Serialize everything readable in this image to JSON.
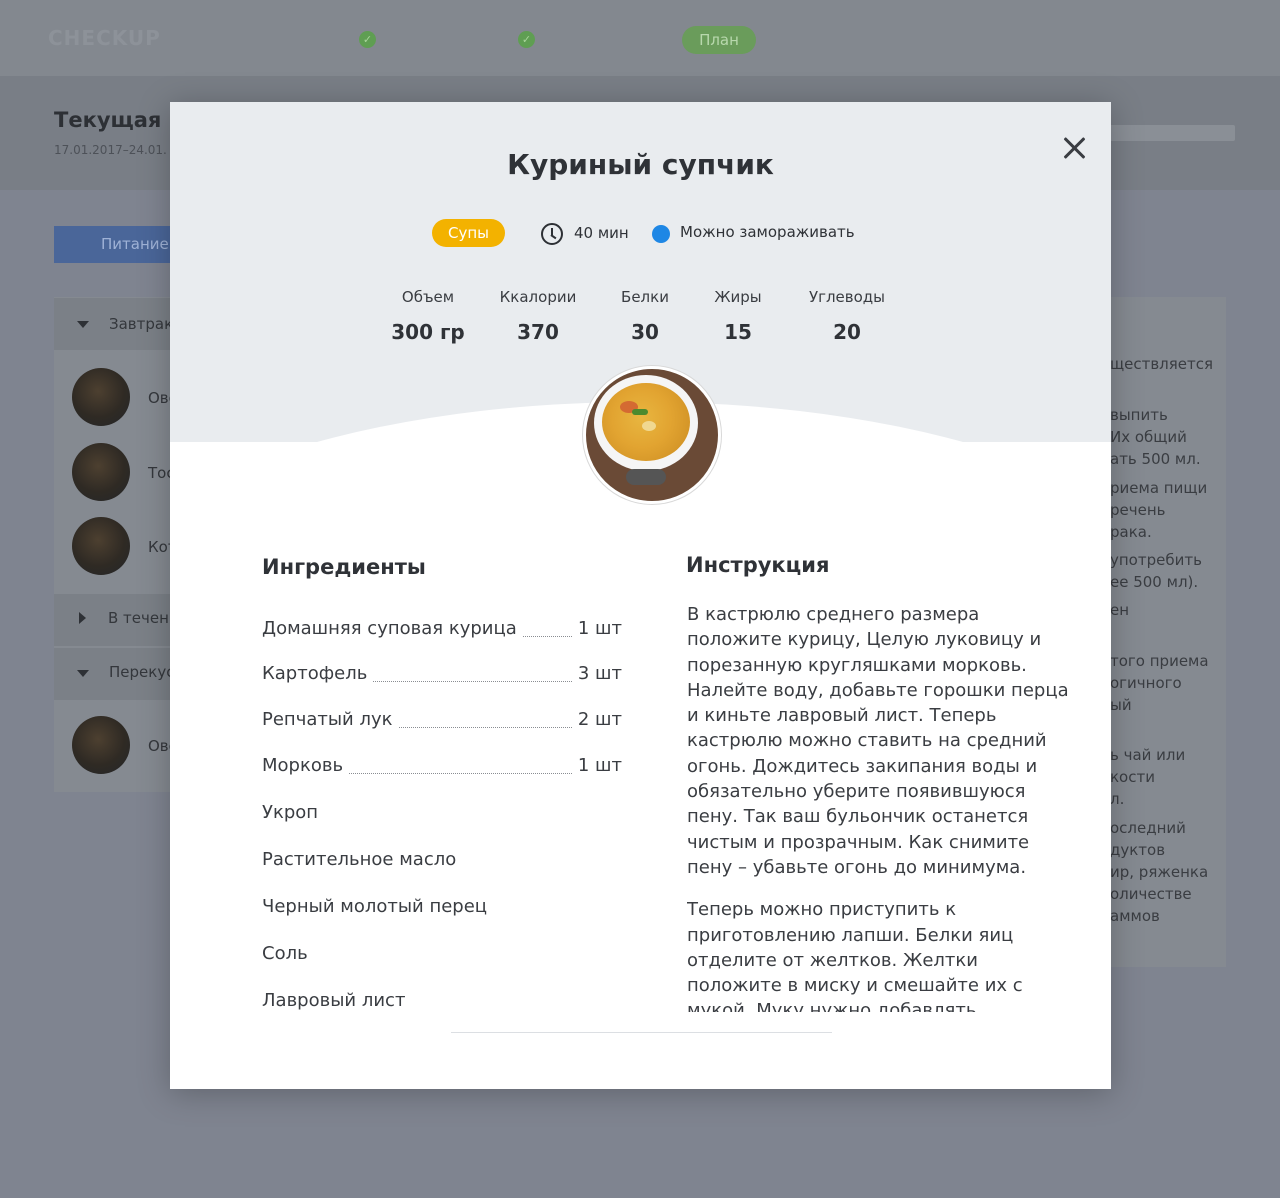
{
  "app": {
    "logo": "CHECKUP",
    "plan_step": "План"
  },
  "page": {
    "title": "Текущая н",
    "dates": "17.01.2017–24.01.",
    "nutrition_tab": "Питание"
  },
  "sidebar": {
    "breakfast": {
      "label": "Завтрак",
      "items": [
        "Ове",
        "Тос",
        "Кот"
      ]
    },
    "during_day": {
      "label": "В течени"
    },
    "snack": {
      "label": "Перекус",
      "items": [
        "Ове"
      ]
    }
  },
  "right_panel_lines": [
    "ществляется",
    "выпить",
    "Их общий",
    "ать 500 мл.",
    "риема пищи",
    "речень",
    "рака.",
    "употребить",
    "ее 500 мл).",
    "ен",
    "того приема",
    "огичного",
    "ый",
    "ь чай или",
    "кости",
    "л.",
    "оследний",
    "дуктов",
    "ир, ряженка",
    "оличестве",
    "аммов"
  ],
  "modal": {
    "title": "Куриный супчик",
    "category": "Супы",
    "time": "40 мин",
    "freeze": "Можно замораживать",
    "nutrition": [
      {
        "label": "Объем",
        "value": "300 гр"
      },
      {
        "label": "Ккалории",
        "value": "370"
      },
      {
        "label": "Белки",
        "value": "30"
      },
      {
        "label": "Жиры",
        "value": "15"
      },
      {
        "label": "Углеводы",
        "value": "20"
      }
    ],
    "ingredients_title": "Ингредиенты",
    "ingredients": [
      {
        "name": "Домашняя суповая курица",
        "qty": "1 шт"
      },
      {
        "name": "Картофель",
        "qty": "3 шт"
      },
      {
        "name": "Репчатый лук",
        "qty": "2 шт"
      },
      {
        "name": "Морковь",
        "qty": "1 шт"
      },
      {
        "name": "Укроп",
        "qty": ""
      },
      {
        "name": "Растительное масло",
        "qty": ""
      },
      {
        "name": "Черный молотый перец",
        "qty": ""
      },
      {
        "name": "Соль",
        "qty": ""
      },
      {
        "name": "Лавровый лист",
        "qty": ""
      }
    ],
    "instructions_title": "Инструкция",
    "instructions": [
      "В кастрюлю среднего размера положите курицу, Целую луковицу и порезанную кругляшками морковь. Налейте воду, добавьте горошки перца и киньте лавровый лист. Теперь кастрюлю можно ставить на средний огонь. Дождитесь закипания воды и обязательно уберите появившуюся пену. Так ваш бульончик останется чистым и прозрачным. Как снимите пену – убавьте огонь до минимума.",
      "Теперь можно приступить к приготовлению лапши. Белки яиц отделите от желтков. Желтки положите в миску и смешайте их с мукой. Муку нужно добавлять постепенно, чтобы"
    ]
  },
  "colors": {
    "accent_badge": "#f3b200",
    "freeze_dot": "#1e87e5",
    "overlay": "#7f8490"
  }
}
